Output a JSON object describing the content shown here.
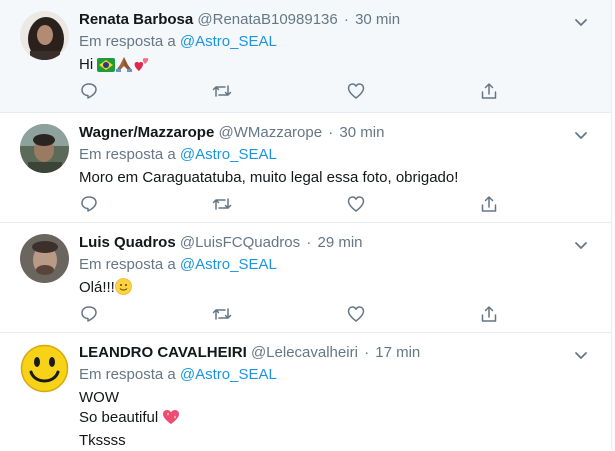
{
  "reply_prefix": "Em resposta a",
  "tweets": [
    {
      "name": "Renata Barbosa",
      "handle": "@RenataB10989136",
      "time": "30 min",
      "reply_to": "@Astro_SEAL",
      "lines": [
        "Hi"
      ],
      "emojis": [
        "brazil-flag",
        "praying-hands",
        "two-hearts"
      ]
    },
    {
      "name": "Wagner/Mazzarope",
      "handle": "@WMazzarope",
      "time": "30 min",
      "reply_to": "@Astro_SEAL",
      "lines": [
        "Moro em Caraguatatuba, muito legal essa foto, obrigado!"
      ]
    },
    {
      "name": "Luis Quadros",
      "handle": "@LuisFCQuadros",
      "time": "29 min",
      "reply_to": "@Astro_SEAL",
      "lines": [
        "Olá!!!"
      ],
      "emojis": [
        "slightly-smiling-face"
      ]
    },
    {
      "name": "LEANDRO CAVALHEIRI",
      "handle": "@Lelecavalheiri",
      "time": "17 min",
      "reply_to": "@Astro_SEAL",
      "lines": [
        "WOW",
        "So beautiful",
        "Tkssss"
      ],
      "emojis": [
        "sparkling-heart"
      ]
    }
  ],
  "separator": "·",
  "colors": {
    "link": "#1b95e0",
    "secondary": "#657786",
    "border": "#e6ecf0",
    "highlight_bg": "#f5f8fa"
  }
}
